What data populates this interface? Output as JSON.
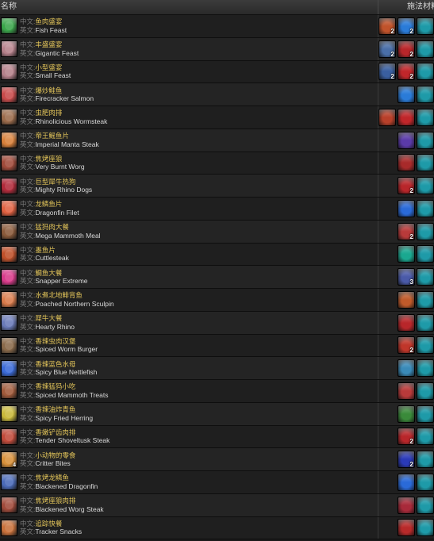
{
  "header": {
    "name": "名称",
    "materials": "施法材料"
  },
  "labels": {
    "zh_prefix": "中文:",
    "en_prefix": "英文:"
  },
  "rows": [
    {
      "zh": "鱼肉盛宴",
      "en": "Fish Feast",
      "icon": "#3aa64a",
      "mats": [
        {
          "c": "#c0532b",
          "n": "2"
        },
        {
          "c": "#2a7bd8",
          "n": "2"
        },
        {
          "c": "#1e9aa8",
          "n": ""
        }
      ]
    },
    {
      "zh": "丰盛盛宴",
      "en": "Gigantic Feast",
      "icon": "#b5808a",
      "mats": [
        {
          "c": "#4a6fa8",
          "n": "2"
        },
        {
          "c": "#b8262a",
          "n": "2"
        },
        {
          "c": "#1e9aa8",
          "n": ""
        }
      ]
    },
    {
      "zh": "小型盛宴",
      "en": "Small Feast",
      "icon": "#b5808a",
      "mats": [
        {
          "c": "#3a5fa0",
          "n": "2"
        },
        {
          "c": "#c0262a",
          "n": "2"
        },
        {
          "c": "#1e9aa8",
          "n": ""
        }
      ]
    },
    {
      "zh": "爆炒鲑鱼",
      "en": "Firecracker Salmon",
      "icon": "#c84a4a",
      "mats": [
        {
          "c": "#2a7bd8",
          "n": ""
        },
        {
          "c": "#1e9aa8",
          "n": ""
        }
      ]
    },
    {
      "zh": "虫肥肉排",
      "en": "Rhinolicious Wormsteak",
      "icon": "#9a6a4a",
      "mats": [
        {
          "c": "#b8402a",
          "n": ""
        },
        {
          "c": "#c0262a",
          "n": ""
        },
        {
          "c": "#1e9aa8",
          "n": ""
        }
      ]
    },
    {
      "zh": "帝王鳐鱼片",
      "en": "Imperial Manta Steak",
      "icon": "#d8803a",
      "mats": [
        {
          "c": "#5a3aa8",
          "n": ""
        },
        {
          "c": "#1e9aa8",
          "n": ""
        }
      ]
    },
    {
      "zh": "焦烤座狼",
      "en": "Very Burnt Worg",
      "icon": "#a04a3a",
      "mats": [
        {
          "c": "#a82a2a",
          "n": ""
        },
        {
          "c": "#1e9aa8",
          "n": ""
        }
      ]
    },
    {
      "zh": "巨型犀牛热狗",
      "en": "Mighty Rhino Dogs",
      "icon": "#b02a3a",
      "mats": [
        {
          "c": "#b8262a",
          "n": "2"
        },
        {
          "c": "#1e9aa8",
          "n": ""
        }
      ]
    },
    {
      "zh": "龙鳞鱼片",
      "en": "Dragonfin Filet",
      "icon": "#e06040",
      "mats": [
        {
          "c": "#2a6ad8",
          "n": ""
        },
        {
          "c": "#1e9aa8",
          "n": ""
        }
      ]
    },
    {
      "zh": "猛犸肉大餐",
      "en": "Mega Mammoth Meal",
      "icon": "#8a5a3a",
      "mats": [
        {
          "c": "#b83a3a",
          "n": "2"
        },
        {
          "c": "#1e9aa8",
          "n": ""
        }
      ]
    },
    {
      "zh": "墨鱼片",
      "en": "Cuttlesteak",
      "icon": "#c0502a",
      "mats": [
        {
          "c": "#1aa890",
          "n": ""
        },
        {
          "c": "#1e9aa8",
          "n": ""
        }
      ]
    },
    {
      "zh": "鲷鱼大餐",
      "en": "Snapper Extreme",
      "icon": "#d83a8a",
      "mats": [
        {
          "c": "#4a5aa8",
          "n": "3"
        },
        {
          "c": "#1e9aa8",
          "n": ""
        }
      ]
    },
    {
      "zh": "水煮北地鲱背鱼",
      "en": "Poached Northern Sculpin",
      "icon": "#d87a4a",
      "mats": [
        {
          "c": "#c05a2a",
          "n": ""
        },
        {
          "c": "#1e9aa8",
          "n": ""
        }
      ]
    },
    {
      "zh": "犀牛大餐",
      "en": "Hearty Rhino",
      "icon": "#6a7ab8",
      "mats": [
        {
          "c": "#b8262a",
          "n": ""
        },
        {
          "c": "#1e9aa8",
          "n": ""
        }
      ]
    },
    {
      "zh": "香辣虫肉汉堡",
      "en": "Spiced Worm Burger",
      "icon": "#8a6a4a",
      "mats": [
        {
          "c": "#c0362a",
          "n": "2"
        },
        {
          "c": "#1e9aa8",
          "n": ""
        }
      ]
    },
    {
      "zh": "香辣蓝色水母",
      "en": "Spicy Blue Nettlefish",
      "icon": "#3a6ad8",
      "mats": [
        {
          "c": "#3a8ab8",
          "n": ""
        },
        {
          "c": "#1e9aa8",
          "n": ""
        }
      ]
    },
    {
      "zh": "香辣猛犸小吃",
      "en": "Spiced Mammoth Treats",
      "icon": "#a05a3a",
      "mats": [
        {
          "c": "#b83a3a",
          "n": ""
        },
        {
          "c": "#1e9aa8",
          "n": ""
        }
      ]
    },
    {
      "zh": "香辣油炸青鱼",
      "en": "Spicy Fried Herring",
      "icon": "#c8b83a",
      "mats": [
        {
          "c": "#3a8a3a",
          "n": ""
        },
        {
          "c": "#1e9aa8",
          "n": ""
        }
      ]
    },
    {
      "zh": "香嫩铲齿肉排",
      "en": "Tender Shoveltusk Steak",
      "icon": "#c04a3a",
      "mats": [
        {
          "c": "#b8262a",
          "n": "2"
        },
        {
          "c": "#1e9aa8",
          "n": ""
        }
      ]
    },
    {
      "zh": "小动物的零食",
      "en": "Critter Bites",
      "icon": "#d8903a",
      "icon_count": "4",
      "mats": [
        {
          "c": "#2a3ab8",
          "n": "2"
        },
        {
          "c": "#1e9aa8",
          "n": ""
        }
      ]
    },
    {
      "zh": "焦烤龙鳞鱼",
      "en": "Blackened Dragonfin",
      "icon": "#4a6ab8",
      "mats": [
        {
          "c": "#2a6ad8",
          "n": ""
        },
        {
          "c": "#1e9aa8",
          "n": ""
        }
      ]
    },
    {
      "zh": "焦烤座狼肉排",
      "en": "Blackened Worg Steak",
      "icon": "#a04a3a",
      "mats": [
        {
          "c": "#a82a3a",
          "n": ""
        },
        {
          "c": "#1e9aa8",
          "n": ""
        }
      ]
    },
    {
      "zh": "追踪快餐",
      "en": "Tracker Snacks",
      "icon": "#c8703a",
      "mats": [
        {
          "c": "#b82a2a",
          "n": ""
        },
        {
          "c": "#1e9aa8",
          "n": ""
        }
      ]
    }
  ]
}
